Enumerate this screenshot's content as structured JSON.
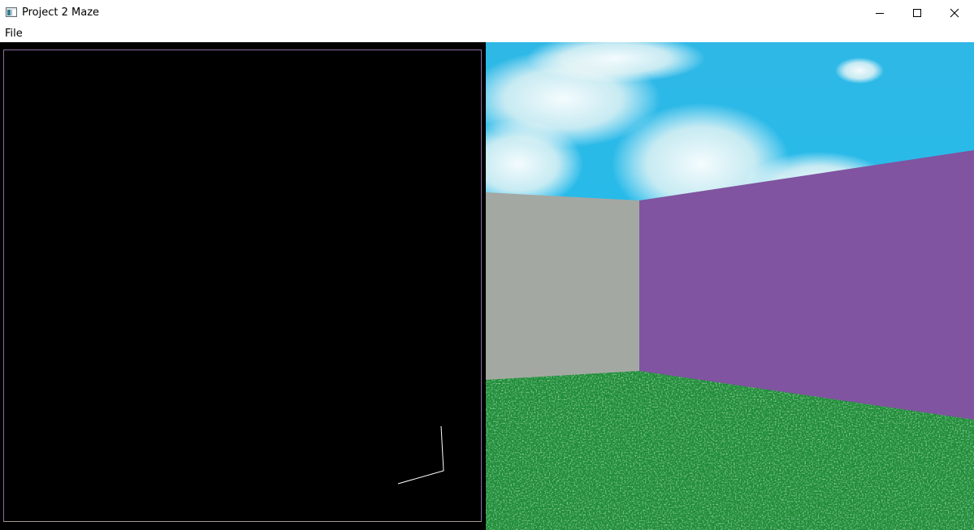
{
  "window": {
    "title": "Project 2 Maze"
  },
  "menu": {
    "items": [
      {
        "label": "File"
      }
    ]
  },
  "colors": {
    "map_background": "#000000",
    "map_border": "#8a6fa0",
    "viewer_marker": "#ffffff",
    "sky": "#19bde9",
    "left_wall": "#a4a8a2",
    "right_wall": "#8054a0",
    "floor": "#1f8e3a"
  },
  "icons": {
    "app": "maze-app-icon",
    "minimize": "minimize-icon",
    "maximize": "maximize-icon",
    "close": "close-icon"
  }
}
